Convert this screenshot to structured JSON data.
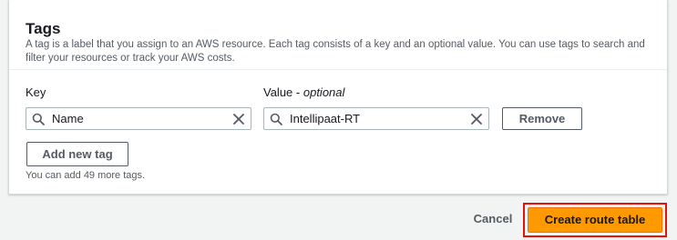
{
  "tags_section": {
    "title": "Tags",
    "description": "A tag is a label that you assign to an AWS resource. Each tag consists of a key and an optional value. You can use tags to search and filter your resources or track your AWS costs.",
    "key_label": "Key",
    "value_label": "Value -",
    "value_label_optional": "optional",
    "tags": [
      {
        "key": "Name",
        "value": "Intellipaat-RT"
      }
    ],
    "remove_label": "Remove",
    "add_tag_label": "Add new tag",
    "remaining_hint": "You can add 49 more tags."
  },
  "footer": {
    "cancel_label": "Cancel",
    "create_label": "Create route table"
  },
  "colors": {
    "primary_button": "#ff9900",
    "highlight_border": "#e3120b"
  },
  "icons": [
    "search-icon",
    "clear-icon"
  ]
}
